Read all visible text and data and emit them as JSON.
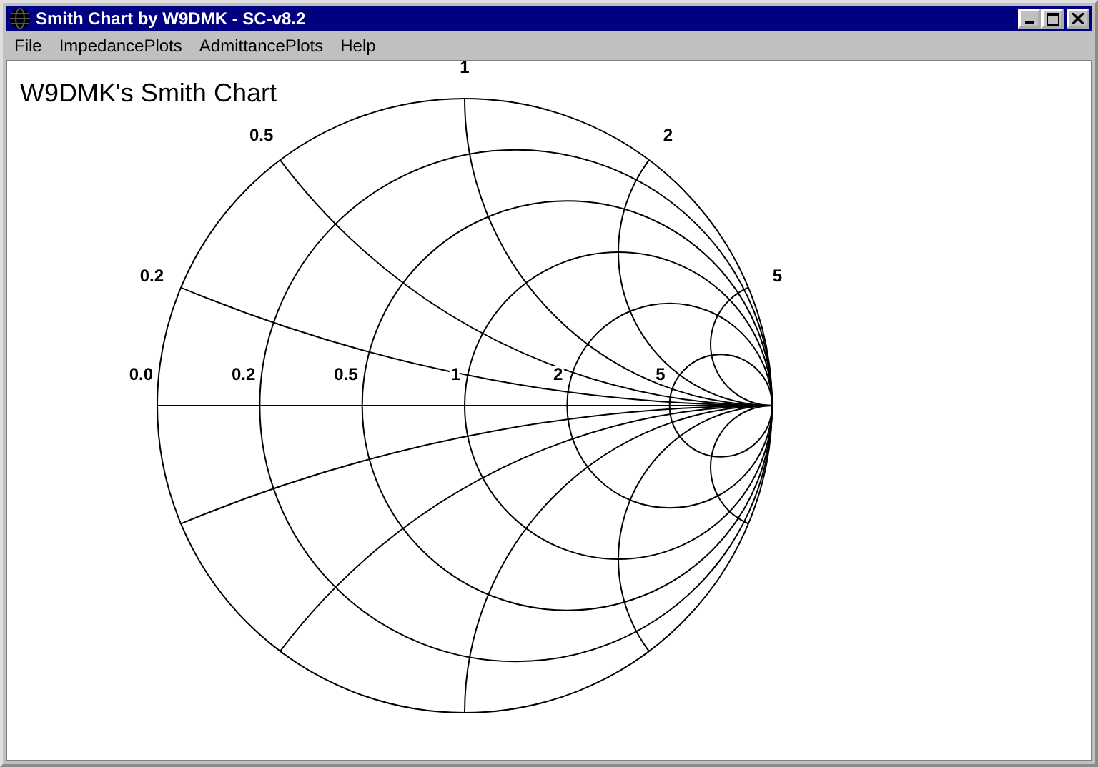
{
  "window": {
    "title": "Smith Chart by W9DMK - SC-v8.2"
  },
  "menu": [
    "File",
    "ImpedancePlots",
    "AdmittancePlots",
    "Help"
  ],
  "chart": {
    "title": "W9DMK's Smith Chart",
    "resistance_labels": [
      "0.0",
      "0.2",
      "0.5",
      "1",
      "2",
      "5"
    ],
    "reactance_labels": [
      "0.2",
      "0.5",
      "1",
      "2",
      "5"
    ]
  }
}
